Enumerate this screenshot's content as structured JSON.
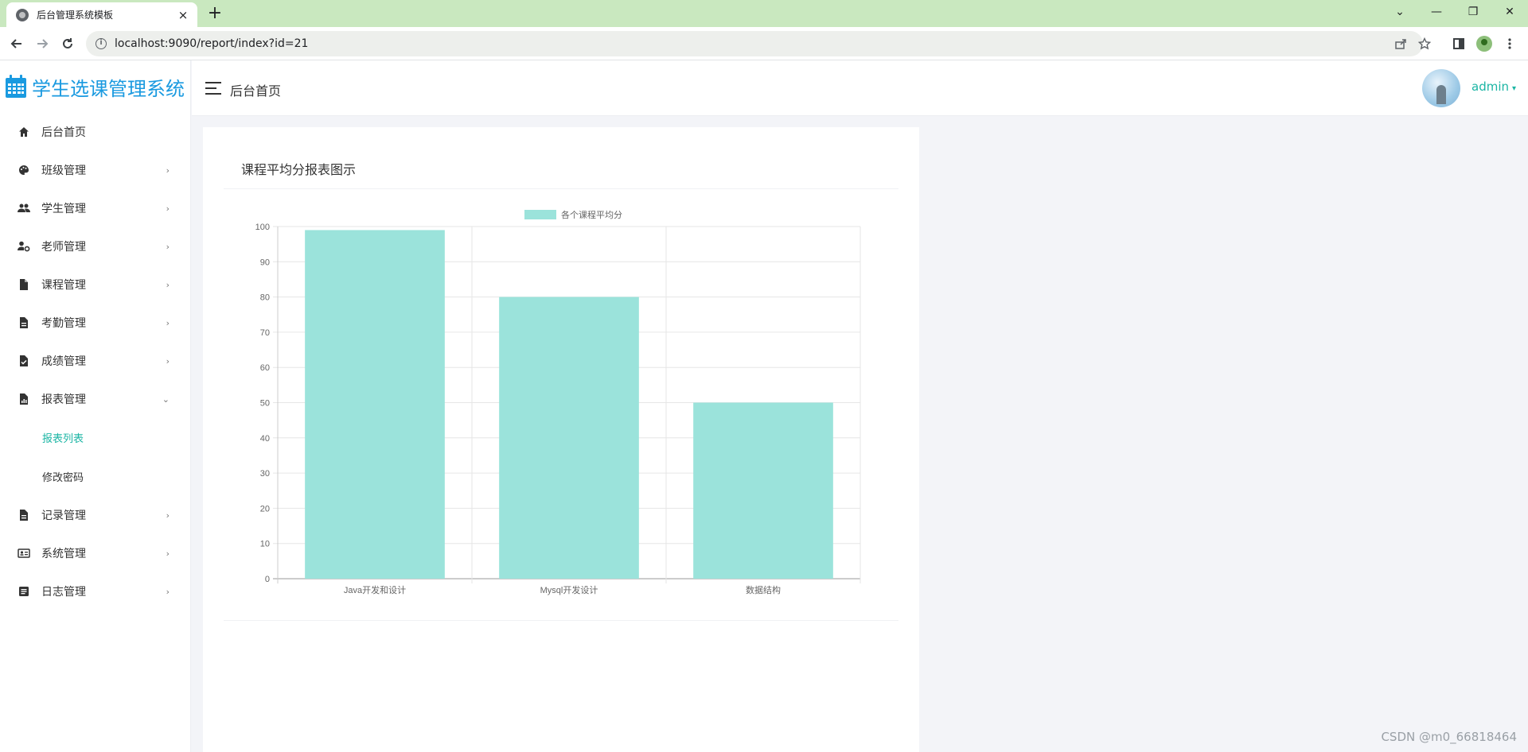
{
  "browser": {
    "tab_title": "后台管理系统模板",
    "tab_close": "×",
    "new_tab": "+",
    "url": "localhost:9090/report/index?id=21",
    "window_controls": [
      "⌄",
      "—",
      "❐",
      "✕"
    ]
  },
  "app": {
    "brand": "学生选课管理系统",
    "breadcrumb": "后台首页",
    "user": "admin",
    "accent_color": "#1bb5a4",
    "brand_color": "#1a9ae0"
  },
  "sidebar": {
    "items": [
      {
        "label": "后台首页",
        "icon": "home-icon",
        "arrow": ""
      },
      {
        "label": "班级管理",
        "icon": "palette-icon",
        "arrow": "›"
      },
      {
        "label": "学生管理",
        "icon": "users-icon",
        "arrow": "›"
      },
      {
        "label": "老师管理",
        "icon": "user-gear-icon",
        "arrow": "›"
      },
      {
        "label": "课程管理",
        "icon": "file-icon",
        "arrow": "›"
      },
      {
        "label": "考勤管理",
        "icon": "file-text-icon",
        "arrow": "›"
      },
      {
        "label": "成绩管理",
        "icon": "file-check-icon",
        "arrow": "›"
      },
      {
        "label": "报表管理",
        "icon": "file-chart-icon",
        "arrow": "⌄"
      }
    ],
    "sub_items": [
      {
        "label": "报表列表",
        "active": true
      },
      {
        "label": "修改密码",
        "active": false
      }
    ],
    "items_after": [
      {
        "label": "记录管理",
        "icon": "file-text-icon",
        "arrow": "›"
      },
      {
        "label": "系统管理",
        "icon": "id-card-icon",
        "arrow": "›"
      },
      {
        "label": "日志管理",
        "icon": "journal-icon",
        "arrow": "›"
      }
    ]
  },
  "card": {
    "title": "课程平均分报表图示"
  },
  "chart_data": {
    "type": "bar",
    "categories": [
      "Java开发和设计",
      "Mysql开发设计",
      "数据结构"
    ],
    "series": [
      {
        "name": "各个课程平均分",
        "values": [
          99,
          80,
          50
        ],
        "color": "#9be3db"
      }
    ],
    "ylim": [
      0,
      100
    ],
    "yticks": [
      0,
      10,
      20,
      30,
      40,
      50,
      60,
      70,
      80,
      90,
      100
    ],
    "grid": true,
    "legend": "top-center"
  },
  "watermark": "CSDN @m0_66818464"
}
